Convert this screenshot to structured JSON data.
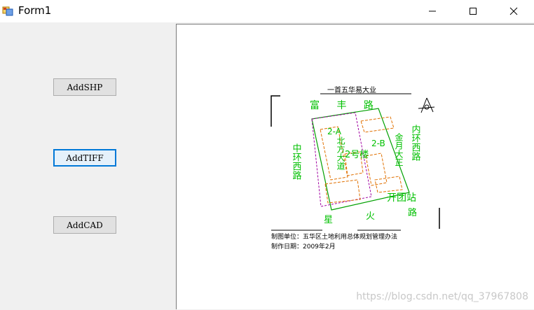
{
  "window": {
    "title": "Form1",
    "controls": {
      "minimize": "minimize",
      "maximize": "maximize",
      "close": "close"
    }
  },
  "buttons": {
    "shp": "AddSHP",
    "tiff": "AddTIFF",
    "cad": "AddCAD"
  },
  "map": {
    "top_title": "一首五华易大业",
    "labels": {
      "road_top": "富  丰  路",
      "road_left": "中环西路",
      "road_right": "内环西路",
      "bld_2a": "2-A",
      "bld_2b": "2-B",
      "bld_2": "2号楼",
      "north_block": "北方大道",
      "east_block": "金月大正",
      "station": "开团站",
      "road_bottom_left": "星",
      "road_bottom_mid": "火",
      "road_bottom_right": "路"
    },
    "footer": [
      "制图单位：五华区土地利用总体规划管理办法",
      "制作日期：2009年2月"
    ],
    "colors": {
      "road_label": "#00c000",
      "outline": "#00a000",
      "parcel": "#a000a0",
      "building": "#e07000"
    }
  },
  "watermark": "https://blog.csdn.net/qq_37967808"
}
